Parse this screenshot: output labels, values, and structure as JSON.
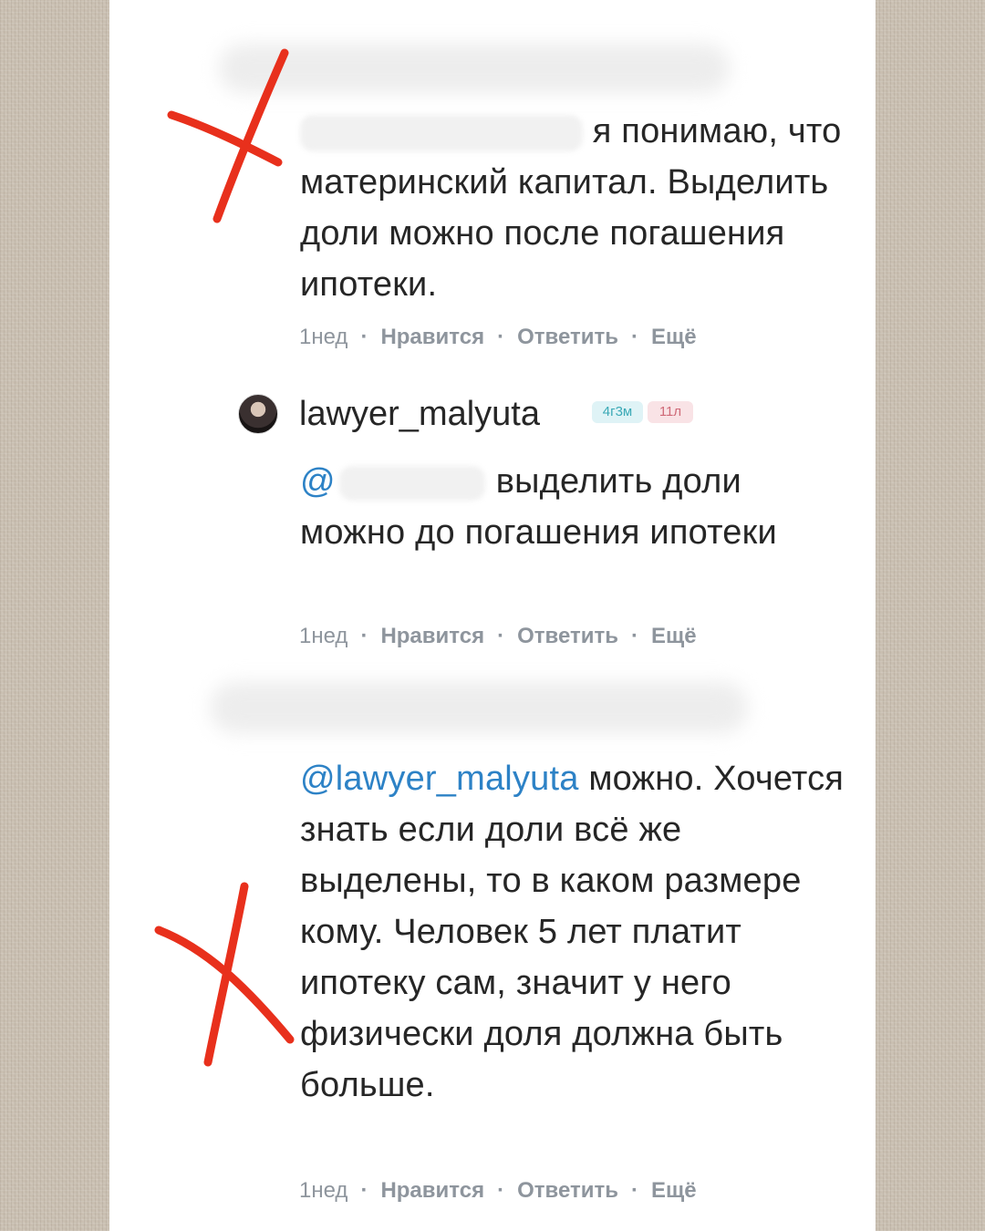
{
  "comments": [
    {
      "text": "я понимаю, что материнский капитал. Выделить доли можно после погашения ипотеки.",
      "time": "1нед",
      "like": "Нравится",
      "reply": "Ответить",
      "more": "Ещё"
    },
    {
      "author": "lawyer_malyuta",
      "badge_time": "4г3м",
      "badge_years": "11л",
      "mention": "@",
      "text": "выделить доли можно до погашения ипотеки",
      "time": "1нед",
      "like": "Нравится",
      "reply": "Ответить",
      "more": "Ещё"
    },
    {
      "mention": "@lawyer_malyuta",
      "text": "можно. Хочется знать если доли всё же выделены, то в каком размере кому. Человек 5 лет платит ипотеку сам, значит у него физически доля должна быть больше.",
      "time": "1нед",
      "like": "Нравится",
      "reply": "Ответить",
      "more": "Ещё"
    }
  ],
  "colors": {
    "mention": "#2d82c6",
    "meta": "#8e959d",
    "cross_mark": "#e8301c",
    "background": "#c9bfb1"
  },
  "icons": [
    "avatar",
    "red-cross-mark"
  ]
}
